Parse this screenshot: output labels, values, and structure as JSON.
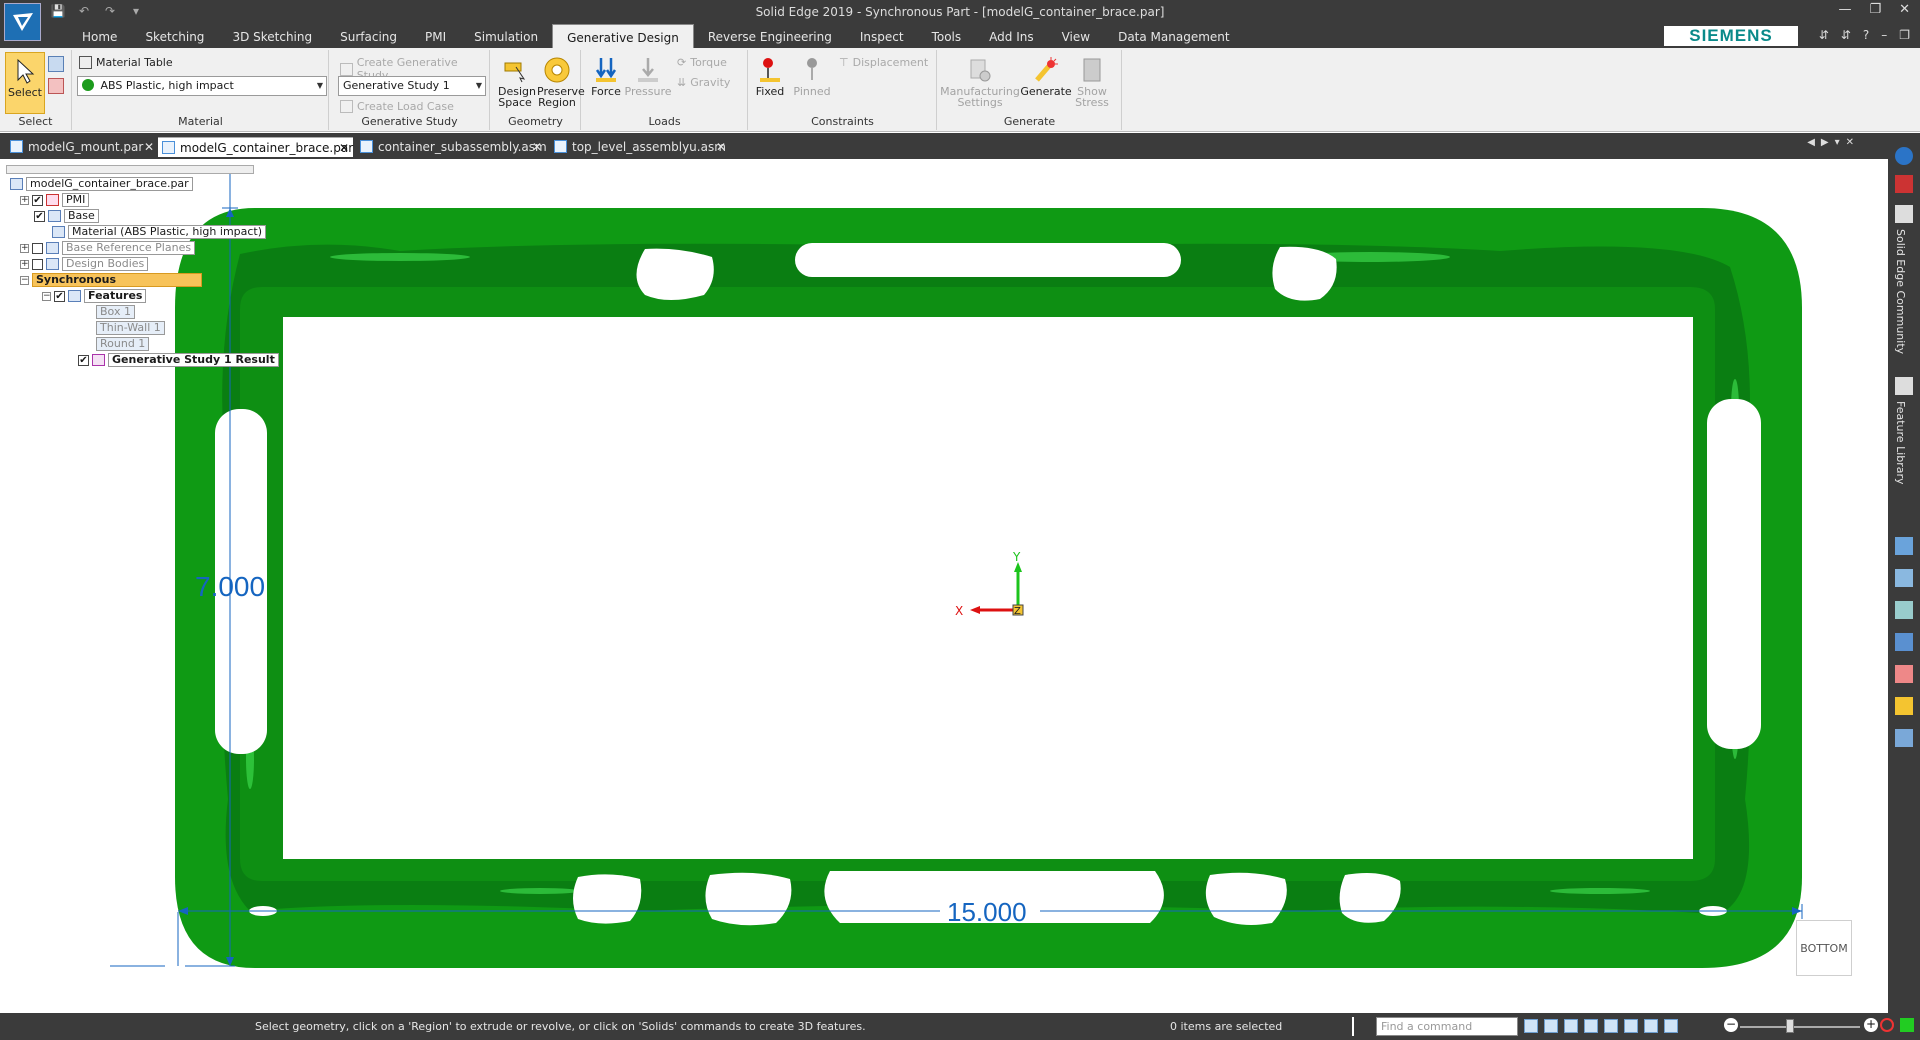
{
  "app": {
    "title": "Solid Edge 2019 - Synchronous Part - [modelG_container_brace.par]",
    "brand": "SIEMENS"
  },
  "menu": {
    "tabs": [
      {
        "label": "Home"
      },
      {
        "label": "Sketching"
      },
      {
        "label": "3D Sketching"
      },
      {
        "label": "Surfacing"
      },
      {
        "label": "PMI"
      },
      {
        "label": "Simulation"
      },
      {
        "label": "Generative Design",
        "active": true
      },
      {
        "label": "Reverse Engineering"
      },
      {
        "label": "Inspect"
      },
      {
        "label": "Tools"
      },
      {
        "label": "Add Ins"
      },
      {
        "label": "View"
      },
      {
        "label": "Data Management"
      }
    ]
  },
  "ribbon": {
    "select": {
      "label": "Select",
      "group": "Select"
    },
    "material": {
      "table_label": "Material Table",
      "value": "ABS Plastic, high impact",
      "group": "Material"
    },
    "study": {
      "create_label": "Create Generative Study",
      "value": "Generative Study 1",
      "create_load_case": "Create Load Case",
      "group": "Generative Study"
    },
    "geometry": {
      "design_space": "Design Space",
      "preserve_region": "Preserve Region",
      "group": "Geometry"
    },
    "loads": {
      "force": "Force",
      "pressure": "Pressure",
      "torque": "Torque",
      "gravity": "Gravity",
      "group": "Loads"
    },
    "constraints": {
      "fixed": "Fixed",
      "pinned": "Pinned",
      "displacement": "Displacement",
      "group": "Constraints"
    },
    "generate": {
      "manufacturing": "Manufacturing Settings",
      "generate": "Generate",
      "show_stress": "Show Stress",
      "group": "Generate"
    }
  },
  "doc_tabs": [
    {
      "label": "modelG_mount.par"
    },
    {
      "label": "modelG_container_brace.par",
      "active": true
    },
    {
      "label": "container_subassembly.asm"
    },
    {
      "label": "top_level_assemblyu.asm"
    }
  ],
  "tree": {
    "root": "modelG_container_brace.par",
    "pmi": "PMI",
    "base": "Base",
    "material": "Material (ABS Plastic, high impact)",
    "ref_planes": "Base Reference Planes",
    "design_bodies": "Design Bodies",
    "synchronous": "Synchronous",
    "features": "Features",
    "box": "Box 1",
    "thin_wall": "Thin-Wall 1",
    "round": "Round 1",
    "result": "Generative Study 1 Result"
  },
  "model": {
    "dim_height": "7.000",
    "dim_width": "15.000",
    "axis_x": "X",
    "axis_y": "Y",
    "axis_z": "Z",
    "view_cube": "BOTTOM",
    "color_body": "#0f9a14",
    "color_dim": "#1565c0"
  },
  "right_panel": {
    "community": "Solid Edge Community",
    "feature_library": "Feature Library"
  },
  "status": {
    "message": "Select geometry, click on a 'Region' to extrude or revolve, or click on 'Solids' commands to create 3D features.",
    "selection": "0 items are selected",
    "find_placeholder": "Find a command"
  }
}
